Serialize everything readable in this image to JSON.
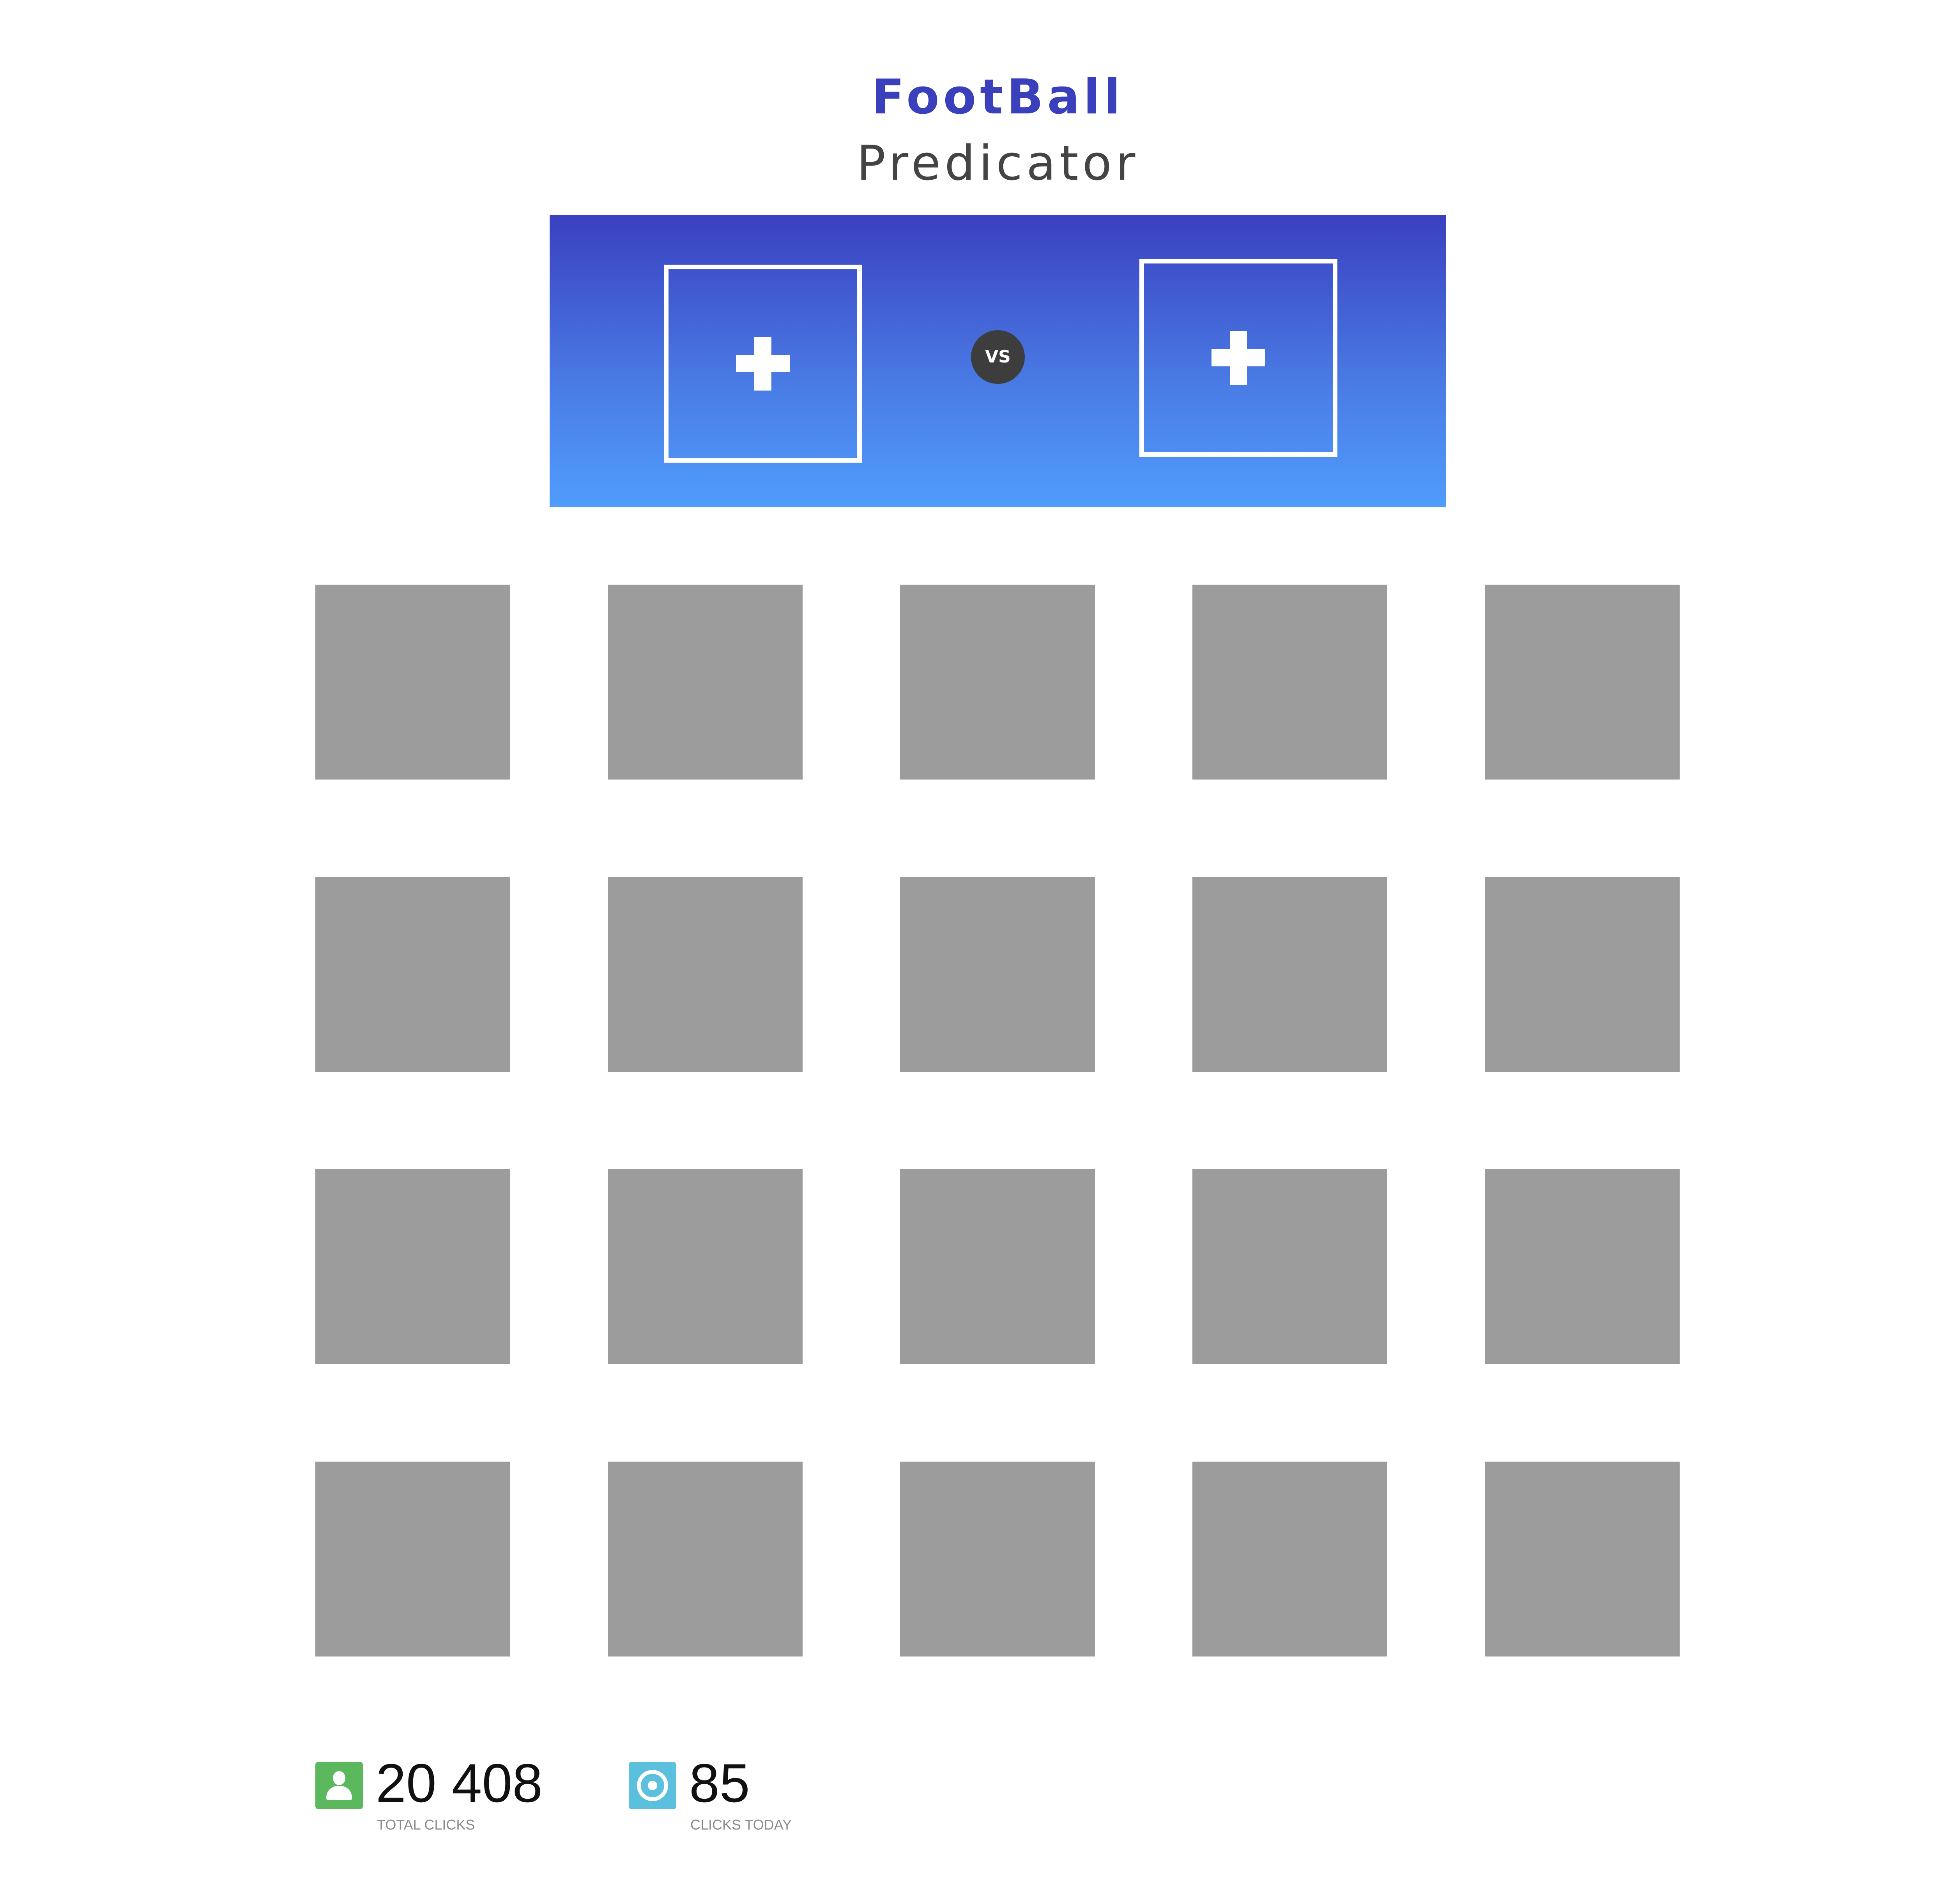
{
  "header": {
    "title": "FootBall",
    "subtitle": "Predicator"
  },
  "matchup": {
    "left_slot_icon": "plus-icon",
    "right_slot_icon": "plus-icon",
    "vs_label": "VS"
  },
  "team_grid": {
    "rows": 4,
    "columns": 5,
    "tile_color": "#9c9c9c"
  },
  "stats": {
    "total": {
      "icon": "user-icon",
      "value": "20 408",
      "label": "TOTAL CLICKS",
      "color": "#5cb85c"
    },
    "today": {
      "icon": "target-icon",
      "value": "85",
      "label": "CLICKS TODAY",
      "color": "#5bc0de"
    }
  },
  "colors": {
    "brand": "#3a3fbb",
    "banner_top": "#3a40c0",
    "banner_bottom": "#509cfd",
    "vs_badge": "#3d3d3d"
  }
}
